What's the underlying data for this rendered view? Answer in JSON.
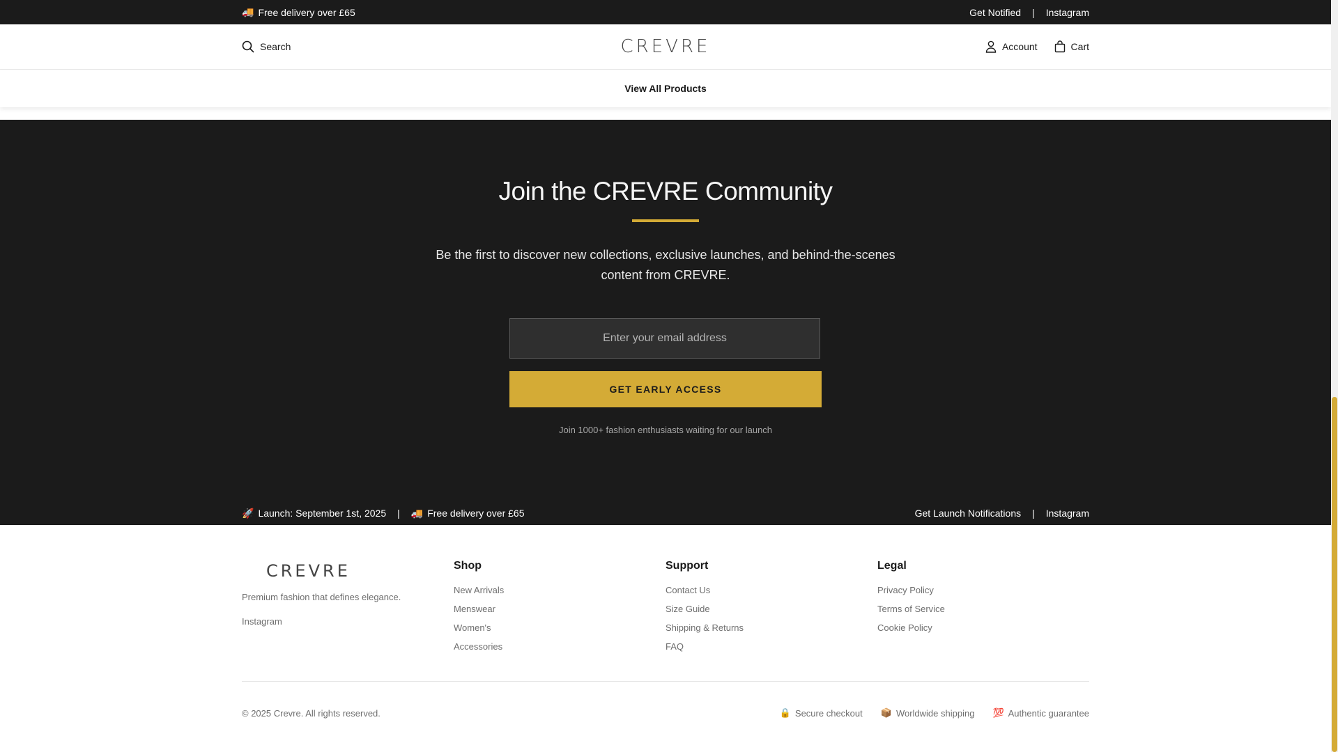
{
  "topbar": {
    "delivery_icon": "🚚",
    "delivery_text": "Free delivery over £65",
    "notify_link": "Get Notified",
    "separator": "|",
    "instagram_link": "Instagram"
  },
  "header": {
    "search_label": "Search",
    "logo": "CREVRE",
    "account_label": "Account",
    "cart_label": "Cart"
  },
  "nav": {
    "view_all": "View All Products"
  },
  "community": {
    "title": "Join the CREVRE Community",
    "description": "Be the first to discover new collections, exclusive launches, and behind-the-scenes content from CREVRE.",
    "email_placeholder": "Enter your email address",
    "cta_label": "GET EARLY ACCESS",
    "note": "Join 1000+ fashion enthusiasts waiting for our launch",
    "accent_color": "#d4ab36"
  },
  "launch_bar": {
    "rocket_icon": "🚀",
    "launch_text": "Launch: September 1st, 2025",
    "separator": "|",
    "delivery_icon": "🚚",
    "delivery_text": "Free delivery over £65",
    "notifications_link": "Get Launch Notifications",
    "instagram_link": "Instagram"
  },
  "footer": {
    "logo": "CREVRE",
    "tagline": "Premium fashion that defines elegance.",
    "instagram_link": "Instagram",
    "columns": [
      {
        "heading": "Shop",
        "links": [
          "New Arrivals",
          "Menswear",
          "Women's",
          "Accessories"
        ]
      },
      {
        "heading": "Support",
        "links": [
          "Contact Us",
          "Size Guide",
          "Shipping & Returns",
          "FAQ"
        ]
      },
      {
        "heading": "Legal",
        "links": [
          "Privacy Policy",
          "Terms of Service",
          "Cookie Policy"
        ]
      }
    ],
    "copyright": "© 2025 Crevre. All rights reserved.",
    "badges": [
      {
        "icon": "🔒",
        "label": "Secure checkout"
      },
      {
        "icon": "📦",
        "label": "Worldwide shipping"
      },
      {
        "icon": "💯",
        "label": "Authentic guarantee"
      }
    ]
  }
}
